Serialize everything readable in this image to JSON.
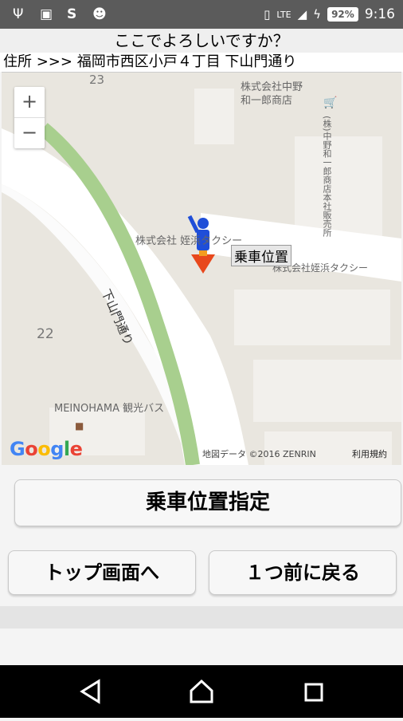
{
  "status_bar": {
    "icons": [
      "usb-icon",
      "image-icon",
      "sync-icon",
      "android-icon"
    ],
    "network": "LTE",
    "battery": "92%",
    "time": "9:16"
  },
  "title": "ここでよろしいですか？",
  "address": "住所 >>> 福岡市西区小戸４丁目  下山門通り",
  "map": {
    "zoom_in": "+",
    "zoom_out": "−",
    "labels": {
      "block_23": "23",
      "block_22": "22",
      "company_nakano": "株式会社中野\n和一郎商店",
      "company_nakano_vertical": "(株)中野和一郎商店本社販売所",
      "taxi_1": "株式会社 姪浜タクシー",
      "taxi_2": "株式会社姪浜タクシー",
      "road": "下山門通り",
      "bus": "MEINOHAMA 観光バス"
    },
    "marker_label": "乗車位置",
    "google": "Google",
    "copyright": "地図データ ©2016 ZENRIN",
    "terms": "利用規約"
  },
  "buttons": {
    "set_location": "乗車位置指定",
    "to_top": "トップ画面へ",
    "back": "１つ前に戻る"
  },
  "colors": {
    "status_bar": "#5b5b5b",
    "nav_bar": "#000000",
    "marker_person": "#1f4ed8",
    "marker_arrow": "#e8481c",
    "road_green": "#a8cf8e"
  }
}
